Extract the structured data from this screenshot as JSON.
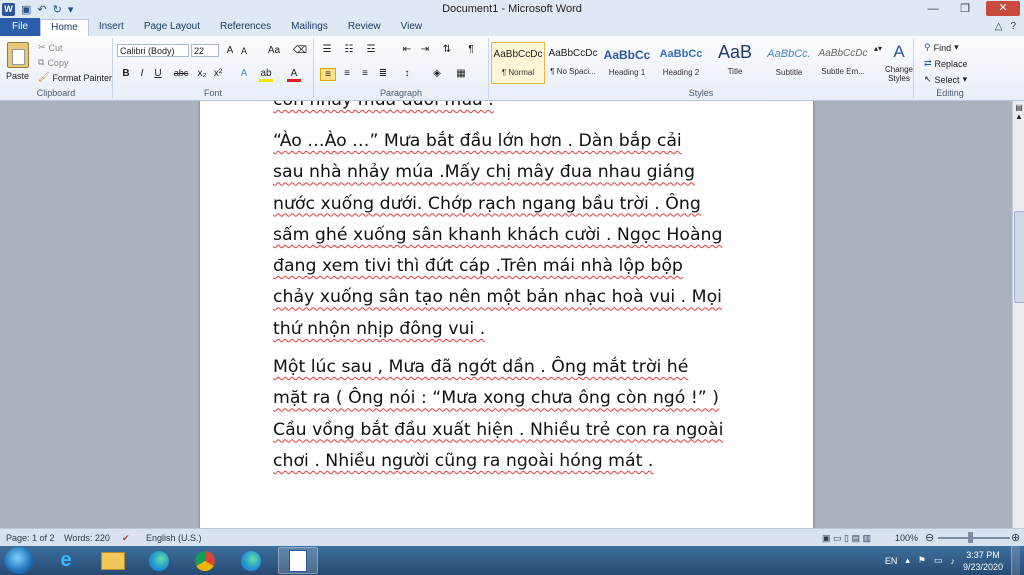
{
  "window": {
    "title": "Document1 - Microsoft Word",
    "app_icon": "W"
  },
  "tabs": [
    "File",
    "Home",
    "Insert",
    "Page Layout",
    "References",
    "Mailings",
    "Review",
    "View"
  ],
  "clipboard": {
    "label": "Clipboard",
    "paste": "Paste",
    "cut": "Cut",
    "copy": "Copy",
    "format_painter": "Format Painter"
  },
  "font": {
    "label": "Font",
    "name": "Calibri (Body)",
    "size": "22",
    "bold": "B",
    "italic": "I",
    "underline": "U",
    "strike": "abc",
    "sub": "x₂",
    "sup": "x²",
    "grow": "A",
    "shrink": "A",
    "case": "Aa",
    "color_a": "A"
  },
  "paragraph": {
    "label": "Paragraph"
  },
  "styles": {
    "label": "Styles",
    "items": [
      {
        "sample": "AaBbCcDc",
        "name": "¶ Normal"
      },
      {
        "sample": "AaBbCcDc",
        "name": "¶ No Spaci..."
      },
      {
        "sample": "AaBbCc",
        "name": "Heading 1"
      },
      {
        "sample": "AaBbCc",
        "name": "Heading 2"
      },
      {
        "sample": "AaB",
        "name": "Title"
      },
      {
        "sample": "AaBbCc.",
        "name": "Subtitle"
      },
      {
        "sample": "AaBbCcDc",
        "name": "Subtle Em..."
      }
    ],
    "change_styles": "Change Styles"
  },
  "editing": {
    "label": "Editing",
    "find": "Find",
    "replace": "Replace",
    "select": "Select"
  },
  "document": {
    "partial_top": "con nhảy múa dưới mưa .",
    "para1": [
      "  “Ào …Ào …” Mưa bắt đầu lớn hơn . Dàn bắp cải",
      "sau nhà nhảy múa .Mấy chị mây đua nhau giáng",
      "nước xuống dưới. Chớp rạch ngang bầu trời . Ông",
      "sấm ghé xuống sân khanh khách cười . Ngọc Hoàng",
      "đang xem tivi thì đứt cáp .Trên mái nhà lộp bộp",
      "chảy xuống sân tạo nên một bản nhạc hoà vui . Mọi",
      "thứ nhộn nhịp đông vui ."
    ],
    "para2": [
      "    Một lúc sau , Mưa đã ngớt dần . Ông mắt trời hé",
      "mặt ra ( Ông nói : “Mưa xong chưa ông còn ngó !” )",
      "Cầu vồng bắt đầu xuất hiện . Nhiều trẻ con ra ngoài",
      "chơi . Nhiều người cũng ra ngoài hóng mát ."
    ]
  },
  "status": {
    "page": "Page: 1 of 2",
    "words": "Words: 220",
    "language": "English (U.S.)",
    "zoom": "100%"
  },
  "taskbar": {
    "lang": "EN",
    "time": "3:37 PM",
    "date": "9/23/2020"
  }
}
